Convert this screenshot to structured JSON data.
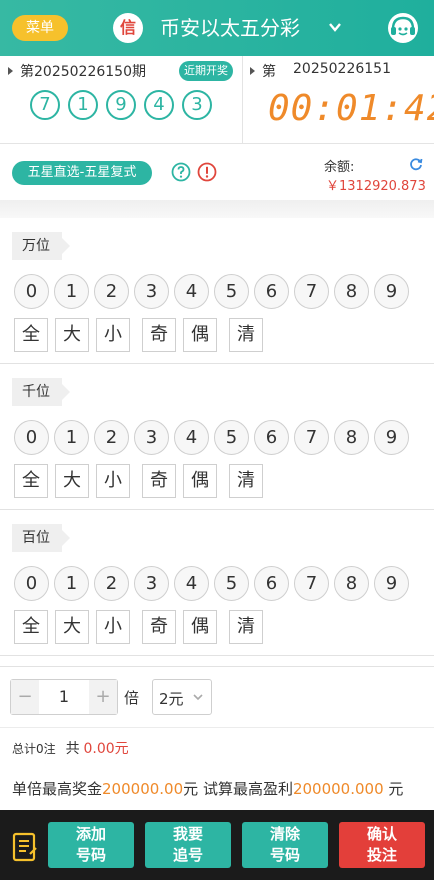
{
  "header": {
    "menu_label": "菜单",
    "xin_label": "信",
    "title": "币安以太五分彩",
    "icons": {
      "title_chevron": "chevron-down-icon",
      "support": "customer-service-icon"
    }
  },
  "draw": {
    "prev_issue": "第20250226150期",
    "recent_label": "近期开奖",
    "balls": [
      "7",
      "1",
      "9",
      "4",
      "3"
    ],
    "next_di": "第",
    "next_issue": "20250226151",
    "countdown": "00:01:42"
  },
  "play": {
    "type_label": "五星直选-五星复式",
    "balance_label": "余额:",
    "balance_value": "￥1312920.873",
    "icons": {
      "help": "help-icon",
      "warning": "warning-icon",
      "refresh": "refresh-icon"
    }
  },
  "sections": [
    {
      "label": "万位",
      "numbers": [
        "0",
        "1",
        "2",
        "3",
        "4",
        "5",
        "6",
        "7",
        "8",
        "9"
      ]
    },
    {
      "label": "千位",
      "numbers": [
        "0",
        "1",
        "2",
        "3",
        "4",
        "5",
        "6",
        "7",
        "8",
        "9"
      ]
    },
    {
      "label": "百位",
      "numbers": [
        "0",
        "1",
        "2",
        "3",
        "4",
        "5",
        "6",
        "7",
        "8",
        "9"
      ]
    }
  ],
  "quick_buttons": [
    "全",
    "大",
    "小",
    "奇",
    "偶",
    "清"
  ],
  "multiplier": {
    "minus": "−",
    "plus": "+",
    "value": "1",
    "bei_label": "倍",
    "unit": "2元"
  },
  "summary": {
    "total_label": "总计0注",
    "gong_label": "共",
    "amount": "0.00元"
  },
  "prize": {
    "label1": "单倍最高奖金",
    "value1": "200000.00",
    "unit1": "元",
    "label2": "试算最高盈利",
    "value2": "200000.000",
    "unit2": "元"
  },
  "footer": {
    "add_line1": "添加",
    "add_line2": "号码",
    "chase_line1": "我要",
    "chase_line2": "追号",
    "clear_line1": "清除",
    "clear_line2": "号码",
    "confirm_line1": "确认",
    "confirm_line2": "投注",
    "icons": {
      "list": "list-icon"
    }
  },
  "colors": {
    "accent": "#2db5a3",
    "menu": "#f6c12c",
    "countdown": "#ef8a2a",
    "danger": "#e33f3a",
    "footer": "#1b1b1b"
  }
}
